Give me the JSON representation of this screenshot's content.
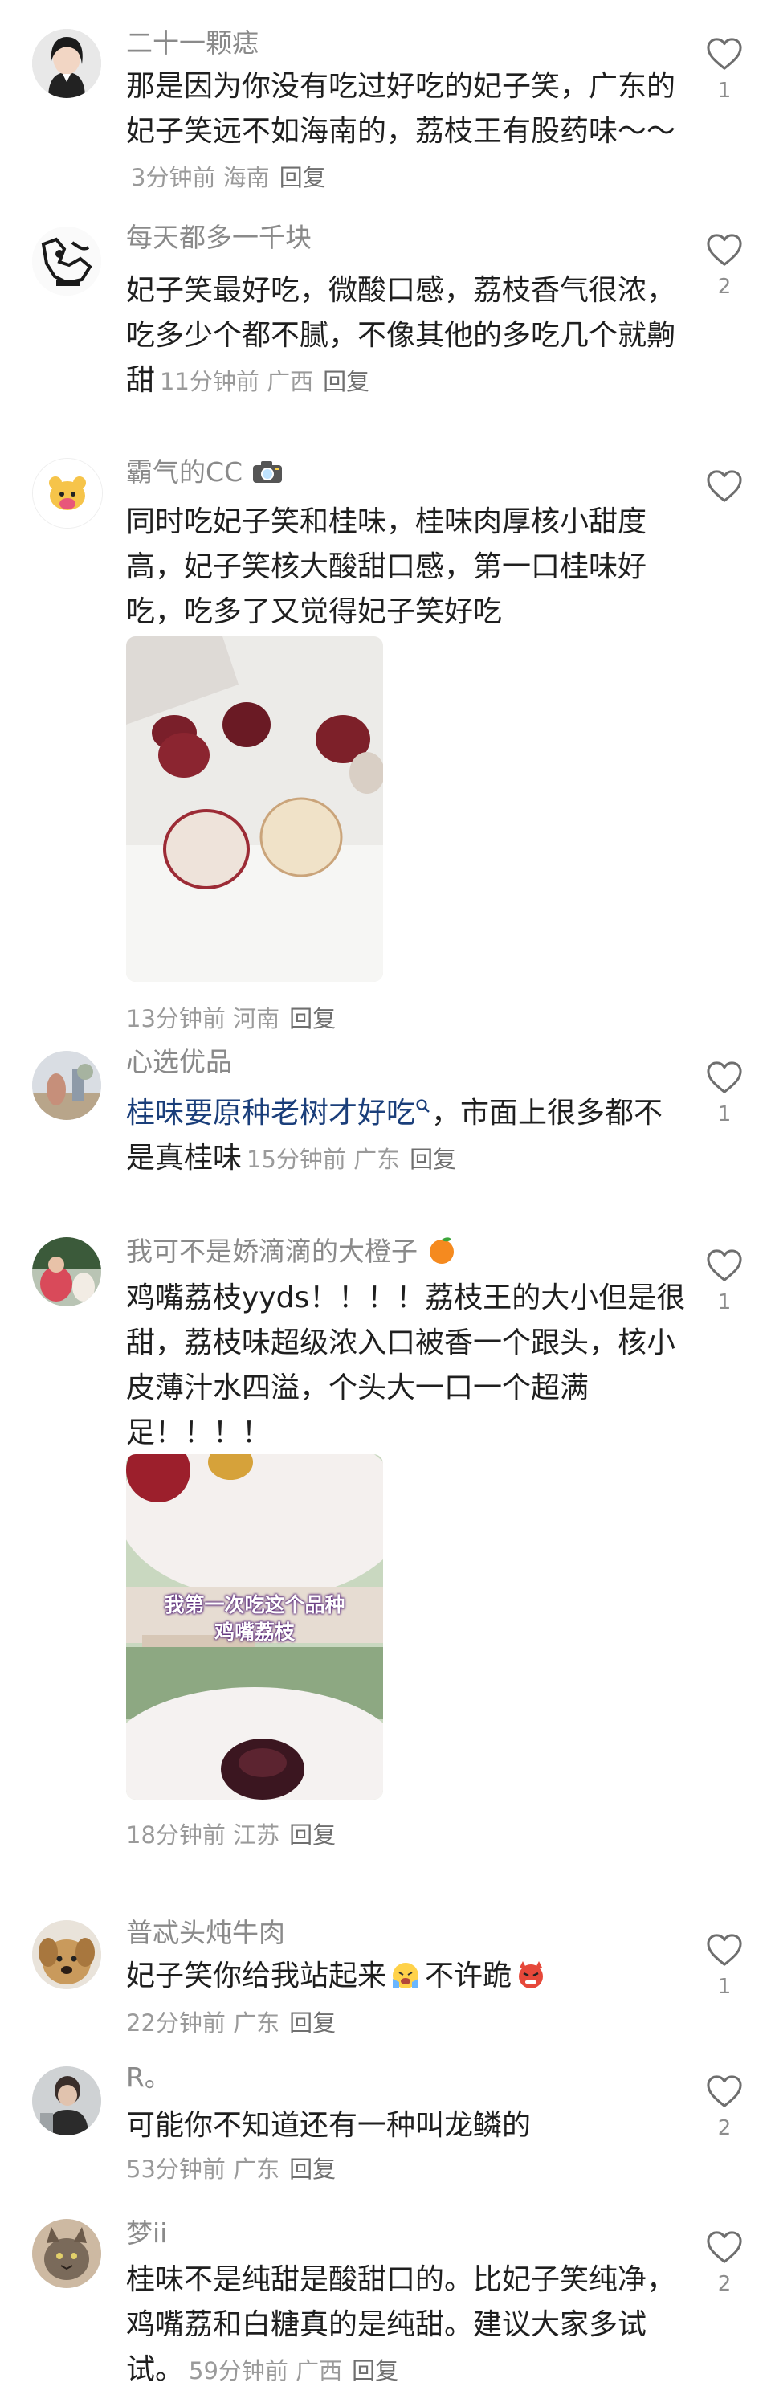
{
  "comments": [
    {
      "name": "二十一颗痣",
      "text": "那是因为你没有吃过好吃的妃子笑，广东的妃子笑远不如海南的，荔枝王有股药味～～",
      "time": "3分钟前",
      "location": "海南",
      "reply": "回复",
      "likes": "1"
    },
    {
      "name": "每天都多一千块",
      "text": "妃子笑最好吃，微酸口感，荔枝香气很浓，吃多少个都不腻，不像其他的多吃几个就齁甜",
      "time": "11分钟前",
      "location": "广西",
      "reply": "回复",
      "likes": "2"
    },
    {
      "name": "霸气的CC",
      "text": "同时吃妃子笑和桂味，桂味肉厚核小甜度高，妃子笑核大酸甜口感，第一口桂味好吃，吃多了又觉得妃子笑好吃",
      "time": "13分钟前",
      "location": "河南",
      "reply": "回复",
      "likes": ""
    },
    {
      "name": "心选优品",
      "link_text": "桂味要原种老树才好吃",
      "text": "，市面上很多都不是真桂味",
      "time": "15分钟前",
      "location": "广东",
      "reply": "回复",
      "likes": "1"
    },
    {
      "name": "我可不是娇滴滴的大橙子",
      "text": "鸡嘴荔枝yyds！！！！荔枝王的大小但是很甜，荔枝味超级浓入口被香一个跟头，核小皮薄汁水四溢，个头大一口一个超满足！！！！",
      "image_caption_1": "我第一次吃这个品种",
      "image_caption_2": "鸡嘴荔枝",
      "time": "18分钟前",
      "location": "江苏",
      "reply": "回复",
      "likes": "1"
    },
    {
      "name": "普忒头炖牛肉",
      "text": "妃子笑你给我站起来",
      "text2": "不许跪",
      "time": "22分钟前",
      "location": "广东",
      "reply": "回复",
      "likes": "1"
    },
    {
      "name": "R。",
      "text": "可能你不知道还有一种叫龙鳞的",
      "time": "53分钟前",
      "location": "广东",
      "reply": "回复",
      "likes": "2"
    },
    {
      "name": "梦ii",
      "text": "桂味不是纯甜是酸甜口的。比妃子笑纯净，鸡嘴荔和白糖真的是纯甜。建议大家多试试。",
      "time": "59分钟前",
      "location": "广西",
      "reply": "回复",
      "likes": "2"
    }
  ],
  "icons": {
    "like": "heart-outline-icon",
    "camera": "camera-icon",
    "search": "search-link-icon"
  },
  "colors": {
    "accent_link": "#1a3e7a",
    "meta": "#9a9a9a"
  }
}
